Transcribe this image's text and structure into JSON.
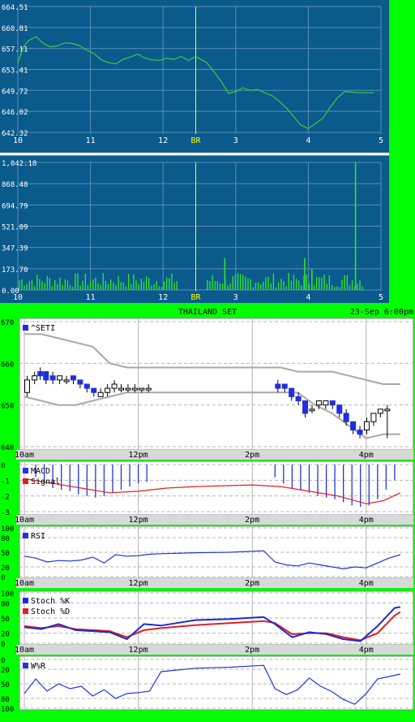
{
  "colors": {
    "page_bg": "#00ff00",
    "top_panel_bg": "#0b5a8c",
    "top_line": "#3ccc3c",
    "top_volume": "#2ee32e",
    "top_grid": "#5d8db5",
    "break_line": "#ffff00",
    "lower_bg": "#ffffff",
    "lower_grid": "#b4b4b4",
    "candle_up": "#ffffff",
    "candle_down": "#1f2fe0",
    "bollinger": "#a8a8a8",
    "macd": "#2233dd",
    "signal": "#e02020",
    "rsi": "#2233dd",
    "stoch_k": "#1a2ad8",
    "stoch_d": "#e02020",
    "wr": "#2233dd",
    "axis_strip": "#d8d8d8"
  },
  "chart_data": [
    {
      "type": "line",
      "panel": "intraday-index",
      "ylim": [
        642.32,
        664.51
      ],
      "y_ticks": [
        "664.51",
        "660.81",
        "657.11",
        "653.41",
        "649.72",
        "646.02",
        "642.32"
      ],
      "x_ticks": [
        "10",
        "11",
        "12",
        "BR",
        "3",
        "4",
        "5"
      ],
      "x_tick_positions": [
        0,
        1,
        2,
        2.45,
        3,
        4,
        5
      ],
      "break_label": "BR",
      "x": [
        0,
        0.08,
        0.15,
        0.25,
        0.35,
        0.45,
        0.55,
        0.65,
        0.75,
        0.85,
        0.95,
        1.05,
        1.15,
        1.25,
        1.35,
        1.45,
        1.55,
        1.65,
        1.75,
        1.85,
        1.95,
        2.05,
        2.15,
        2.25,
        2.35,
        2.45,
        2.6,
        2.7,
        2.8,
        2.9,
        3.0,
        3.1,
        3.2,
        3.3,
        3.4,
        3.5,
        3.6,
        3.7,
        3.8,
        3.9,
        4.0,
        4.1,
        4.2,
        4.3,
        4.4,
        4.5,
        4.6,
        4.7,
        4.8,
        4.9
      ],
      "y": [
        654.5,
        657.5,
        658.5,
        659.2,
        658.0,
        657.4,
        657.6,
        658.1,
        658.0,
        657.6,
        656.8,
        656.2,
        655.1,
        654.6,
        654.4,
        655.2,
        655.6,
        656.1,
        655.4,
        655.1,
        655.0,
        655.4,
        655.2,
        655.7,
        655.0,
        655.7,
        654.6,
        653.0,
        651.3,
        649.2,
        649.5,
        650.2,
        649.7,
        649.9,
        649.3,
        648.8,
        647.8,
        646.6,
        645.1,
        643.6,
        643.0,
        643.9,
        644.8,
        646.7,
        648.4,
        649.5,
        649.4,
        649.3,
        649.3,
        649.3
      ]
    },
    {
      "type": "bar",
      "panel": "intraday-volume",
      "ylim": [
        0,
        1042.18
      ],
      "y_ticks": [
        "1,042.18",
        "868.48",
        "694.79",
        "521.09",
        "347.39",
        "173.70",
        "0.00"
      ],
      "x_ticks": [
        "10",
        "11",
        "12",
        "BR",
        "3",
        "4",
        "5"
      ],
      "x_tick_positions": [
        0,
        1,
        2,
        2.45,
        3,
        4,
        5
      ],
      "spikes": [
        {
          "x": 2.85,
          "value": 260
        },
        {
          "x": 3.95,
          "value": 260
        },
        {
          "x": 4.05,
          "value": 170
        },
        {
          "x": 4.65,
          "value": 1042.18
        }
      ],
      "typical_range": [
        20,
        140
      ]
    },
    {
      "type": "candlestick",
      "panel": "daily-price",
      "title": "THAILAND SET",
      "timestamp": "23-Sep 6:00pm",
      "legend": "^SETI",
      "ylim": [
        640,
        670
      ],
      "y_ticks": [
        "670",
        "660",
        "650",
        "640"
      ],
      "x_ticks": [
        "10am",
        "12pm",
        "2pm",
        "4pm"
      ],
      "x_tick_positions": [
        0,
        2,
        4,
        6
      ],
      "candles": [
        {
          "x": 0.05,
          "o": 653,
          "c": 656,
          "h": 657,
          "l": 652
        },
        {
          "x": 0.18,
          "o": 656,
          "c": 657,
          "h": 658,
          "l": 655
        },
        {
          "x": 0.28,
          "o": 658,
          "c": 657,
          "h": 659,
          "l": 656
        },
        {
          "x": 0.38,
          "o": 658,
          "c": 656,
          "h": 658,
          "l": 655
        },
        {
          "x": 0.5,
          "o": 657,
          "c": 656,
          "h": 658,
          "l": 655
        },
        {
          "x": 0.62,
          "o": 656,
          "c": 657,
          "h": 657,
          "l": 655
        },
        {
          "x": 0.74,
          "o": 656,
          "c": 656,
          "h": 657,
          "l": 655
        },
        {
          "x": 0.86,
          "o": 657,
          "c": 656,
          "h": 657,
          "l": 655
        },
        {
          "x": 0.98,
          "o": 656,
          "c": 655,
          "h": 656,
          "l": 654
        },
        {
          "x": 1.1,
          "o": 655,
          "c": 654,
          "h": 655,
          "l": 653
        },
        {
          "x": 1.22,
          "o": 654,
          "c": 653,
          "h": 654,
          "l": 652
        },
        {
          "x": 1.34,
          "o": 652,
          "c": 653,
          "h": 654,
          "l": 652
        },
        {
          "x": 1.46,
          "o": 653,
          "c": 654,
          "h": 655,
          "l": 652
        },
        {
          "x": 1.58,
          "o": 654,
          "c": 655,
          "h": 656,
          "l": 653
        },
        {
          "x": 1.7,
          "o": 654,
          "c": 654,
          "h": 655,
          "l": 653
        },
        {
          "x": 1.82,
          "o": 654,
          "c": 654,
          "h": 655,
          "l": 653
        },
        {
          "x": 1.94,
          "o": 654,
          "c": 654,
          "h": 655,
          "l": 653
        },
        {
          "x": 2.06,
          "o": 654,
          "c": 654,
          "h": 654,
          "l": 653
        },
        {
          "x": 2.18,
          "o": 654,
          "c": 654,
          "h": 655,
          "l": 653
        },
        {
          "x": 4.45,
          "o": 655,
          "c": 654,
          "h": 656,
          "l": 653
        },
        {
          "x": 4.57,
          "o": 655,
          "c": 654,
          "h": 655,
          "l": 653
        },
        {
          "x": 4.69,
          "o": 654,
          "c": 652,
          "h": 654,
          "l": 651
        },
        {
          "x": 4.81,
          "o": 652,
          "c": 651,
          "h": 653,
          "l": 650
        },
        {
          "x": 4.93,
          "o": 651,
          "c": 648,
          "h": 651,
          "l": 647
        },
        {
          "x": 5.05,
          "o": 649,
          "c": 649,
          "h": 650,
          "l": 648
        },
        {
          "x": 5.17,
          "o": 650,
          "c": 651,
          "h": 651,
          "l": 649
        },
        {
          "x": 5.29,
          "o": 650,
          "c": 651,
          "h": 651,
          "l": 649
        },
        {
          "x": 5.41,
          "o": 651,
          "c": 650,
          "h": 651,
          "l": 649
        },
        {
          "x": 5.53,
          "o": 650,
          "c": 648,
          "h": 650,
          "l": 647
        },
        {
          "x": 5.65,
          "o": 648,
          "c": 646,
          "h": 649,
          "l": 645
        },
        {
          "x": 5.77,
          "o": 646,
          "c": 644,
          "h": 646,
          "l": 643
        },
        {
          "x": 5.89,
          "o": 644,
          "c": 643,
          "h": 645,
          "l": 642
        },
        {
          "x": 6.01,
          "o": 644,
          "c": 646,
          "h": 647,
          "l": 643
        },
        {
          "x": 6.13,
          "o": 646,
          "c": 648,
          "h": 648,
          "l": 645
        },
        {
          "x": 6.25,
          "o": 648,
          "c": 649,
          "h": 649,
          "l": 647
        },
        {
          "x": 6.37,
          "o": 649,
          "c": 649,
          "h": 650,
          "l": 642
        }
      ],
      "band_x": [
        0,
        0.3,
        0.6,
        0.9,
        1.2,
        1.5,
        1.8,
        2.1,
        2.4,
        2.7,
        3.0,
        3.3,
        3.6,
        3.9,
        4.2,
        4.5,
        4.8,
        5.1,
        5.4,
        5.7,
        6.0,
        6.3,
        6.6
      ],
      "band_upper": [
        667,
        667,
        666,
        665,
        664,
        660,
        659,
        659,
        659,
        659,
        659,
        659,
        659,
        659,
        659,
        659,
        658,
        658,
        658,
        657,
        656,
        655,
        655
      ],
      "band_lower": [
        652,
        651,
        650,
        650,
        651,
        652,
        653,
        653,
        653,
        653,
        653,
        653,
        653,
        653,
        653,
        653,
        653,
        650,
        648,
        645,
        642,
        643,
        643
      ]
    },
    {
      "type": "line",
      "panel": "macd",
      "legend": [
        "MACD",
        "Signal"
      ],
      "ylim": [
        -3,
        0
      ],
      "y_ticks": [
        "0",
        "-1",
        "-2",
        "-3"
      ],
      "x_ticks": [
        "10am",
        "12pm",
        "2pm",
        "4pm"
      ],
      "x_tick_positions": [
        0,
        2,
        4,
        6
      ],
      "macd_x": [
        0.2,
        0.35,
        0.5,
        0.65,
        0.8,
        0.95,
        1.1,
        1.25,
        1.4,
        1.55,
        1.7,
        1.85,
        2.0,
        2.15,
        4.4,
        4.55,
        4.7,
        4.85,
        5.0,
        5.15,
        5.3,
        5.45,
        5.6,
        5.75,
        5.9,
        6.05,
        6.2,
        6.35,
        6.5
      ],
      "macd": [
        -0.8,
        -1.2,
        -1.5,
        -1.6,
        -1.7,
        -1.9,
        -2.0,
        -2.1,
        -2.0,
        -1.8,
        -1.6,
        -1.4,
        -1.2,
        -1.1,
        -0.8,
        -1.2,
        -1.5,
        -1.6,
        -1.8,
        -2.0,
        -2.1,
        -2.2,
        -2.4,
        -2.6,
        -2.7,
        -2.6,
        -2.2,
        -1.6,
        -1.0
      ],
      "signal_x": [
        0,
        0.5,
        1.0,
        1.5,
        2.0,
        2.5,
        3.0,
        3.5,
        4.0,
        4.5,
        5.0,
        5.5,
        6.0,
        6.3,
        6.6
      ],
      "signal": [
        -0.9,
        -1.2,
        -1.5,
        -1.8,
        -1.7,
        -1.5,
        -1.4,
        -1.35,
        -1.3,
        -1.4,
        -1.7,
        -2.0,
        -2.5,
        -2.3,
        -1.8
      ]
    },
    {
      "type": "line",
      "panel": "rsi",
      "legend": [
        "RSI"
      ],
      "ylim": [
        0,
        100
      ],
      "y_ticks": [
        "100",
        "80",
        "50",
        "20",
        "0"
      ],
      "x_ticks": [
        "10am",
        "12pm",
        "2pm",
        "4pm"
      ],
      "x_tick_positions": [
        0,
        2,
        4,
        6
      ],
      "x": [
        0,
        0.2,
        0.4,
        0.6,
        0.8,
        1.0,
        1.2,
        1.4,
        1.6,
        1.8,
        2.0,
        2.2,
        2.4,
        3.0,
        3.6,
        4.2,
        4.4,
        4.6,
        4.8,
        5.0,
        5.2,
        5.4,
        5.6,
        5.8,
        6.0,
        6.2,
        6.4,
        6.6
      ],
      "y": [
        42,
        38,
        30,
        33,
        32,
        34,
        40,
        28,
        45,
        42,
        43,
        46,
        47,
        49,
        50,
        53,
        30,
        24,
        22,
        28,
        24,
        20,
        16,
        20,
        18,
        28,
        38,
        45
      ]
    },
    {
      "type": "line",
      "panel": "stochastic",
      "legend": [
        "Stoch %K",
        "Stoch %D"
      ],
      "ylim": [
        0,
        100
      ],
      "y_ticks": [
        "100",
        "80",
        "50",
        "20",
        "0"
      ],
      "x_ticks": [
        "10am",
        "12pm",
        "2pm",
        "4pm"
      ],
      "x_tick_positions": [
        0,
        2,
        4,
        6
      ],
      "k_x": [
        0,
        0.3,
        0.6,
        0.9,
        1.2,
        1.5,
        1.8,
        2.1,
        2.4,
        3.0,
        3.6,
        4.2,
        4.4,
        4.7,
        5.0,
        5.3,
        5.6,
        5.9,
        6.2,
        6.5,
        6.6
      ],
      "k": [
        32,
        28,
        38,
        26,
        24,
        22,
        8,
        38,
        35,
        46,
        48,
        52,
        38,
        12,
        22,
        18,
        8,
        4,
        34,
        70,
        72
      ],
      "d_x": [
        0,
        0.3,
        0.6,
        0.9,
        1.2,
        1.5,
        1.8,
        2.1,
        2.4,
        3.0,
        3.6,
        4.2,
        4.4,
        4.7,
        5.0,
        5.3,
        5.6,
        5.9,
        6.2,
        6.5,
        6.6
      ],
      "d": [
        34,
        30,
        34,
        28,
        26,
        24,
        12,
        26,
        30,
        36,
        40,
        44,
        40,
        18,
        20,
        20,
        12,
        6,
        20,
        55,
        62
      ]
    },
    {
      "type": "line",
      "panel": "williams-r",
      "legend": [
        "W%R"
      ],
      "ylim": [
        0,
        100
      ],
      "y_ticks": [
        "0",
        "20",
        "50",
        "80",
        "100"
      ],
      "x_ticks": [
        "10am",
        "12pm",
        "2pm",
        "4pm"
      ],
      "x_tick_positions": [
        0,
        2,
        4,
        6
      ],
      "x": [
        0,
        0.2,
        0.4,
        0.6,
        0.8,
        1.0,
        1.2,
        1.4,
        1.6,
        1.8,
        2.0,
        2.2,
        2.4,
        3.0,
        3.6,
        4.2,
        4.4,
        4.6,
        4.8,
        5.0,
        5.2,
        5.4,
        5.6,
        5.8,
        6.0,
        6.2,
        6.4,
        6.6
      ],
      "y": [
        70,
        40,
        65,
        50,
        60,
        55,
        75,
        62,
        80,
        70,
        68,
        65,
        25,
        18,
        16,
        12,
        60,
        72,
        62,
        38,
        55,
        66,
        82,
        92,
        70,
        40,
        35,
        30
      ]
    }
  ]
}
